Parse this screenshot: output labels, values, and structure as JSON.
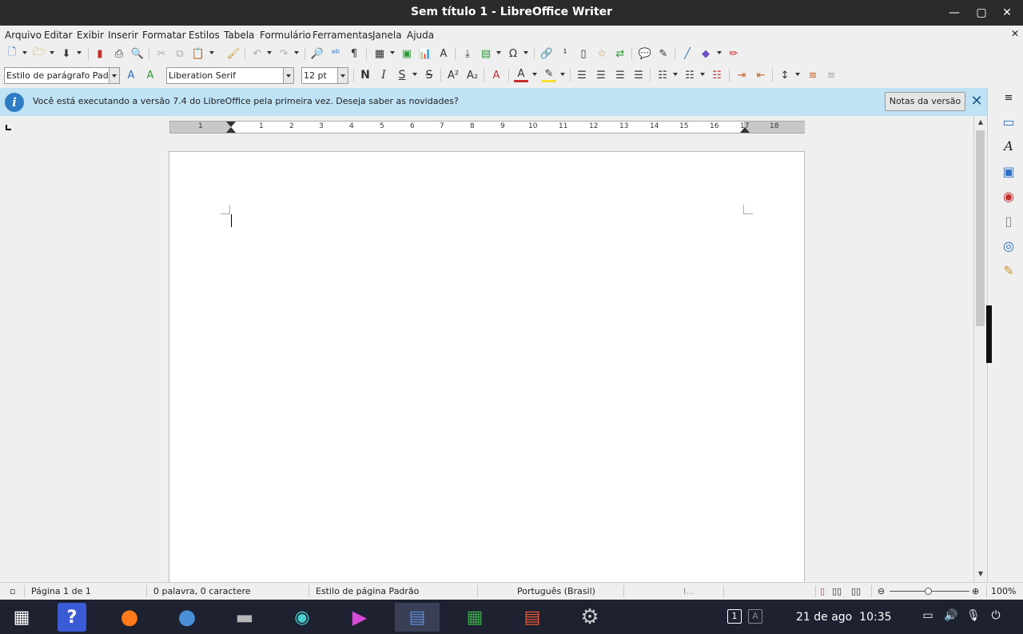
{
  "window": {
    "title": "Sem título 1 - LibreOffice Writer"
  },
  "menu": [
    "Arquivo",
    "Editar",
    "Exibir",
    "Inserir",
    "Formatar",
    "Estilos",
    "Tabela",
    "Formulário",
    "Ferramentas",
    "Janela",
    "Ajuda"
  ],
  "formatting": {
    "paragraph_style": "Estilo de parágrafo Padrão",
    "font_name": "Liberation Serif",
    "font_size": "12 pt",
    "bold_label": "N",
    "italic_label": "I",
    "underline_label": "S",
    "strike_label": "S"
  },
  "infobar": {
    "message": "Você está executando a versão 7.4 do LibreOffice pela primeira vez. Deseja saber as novidades?",
    "button": "Notas da versão",
    "close": "✕"
  },
  "ruler": {
    "labels": [
      "1",
      "1",
      "2",
      "3",
      "4",
      "5",
      "6",
      "7",
      "8",
      "9",
      "10",
      "11",
      "12",
      "13",
      "14",
      "15",
      "16",
      "17",
      "18"
    ]
  },
  "status": {
    "page": "Página 1 de 1",
    "words": "0 palavra, 0 caractere",
    "page_style": "Estilo de página Padrão",
    "language": "Português (Brasil)",
    "selection_mode": "I...",
    "zoom": "100%",
    "zoom_level": 1.0
  },
  "taskbar": {
    "date": "21 de ago",
    "time": "10:35",
    "workspace": "1",
    "workspace2": "A"
  },
  "colors": {
    "accent": "#2e7cc4",
    "infobar": "#bfe2f5",
    "titlebar": "#2b2b2b",
    "taskbar": "#1e2130"
  }
}
